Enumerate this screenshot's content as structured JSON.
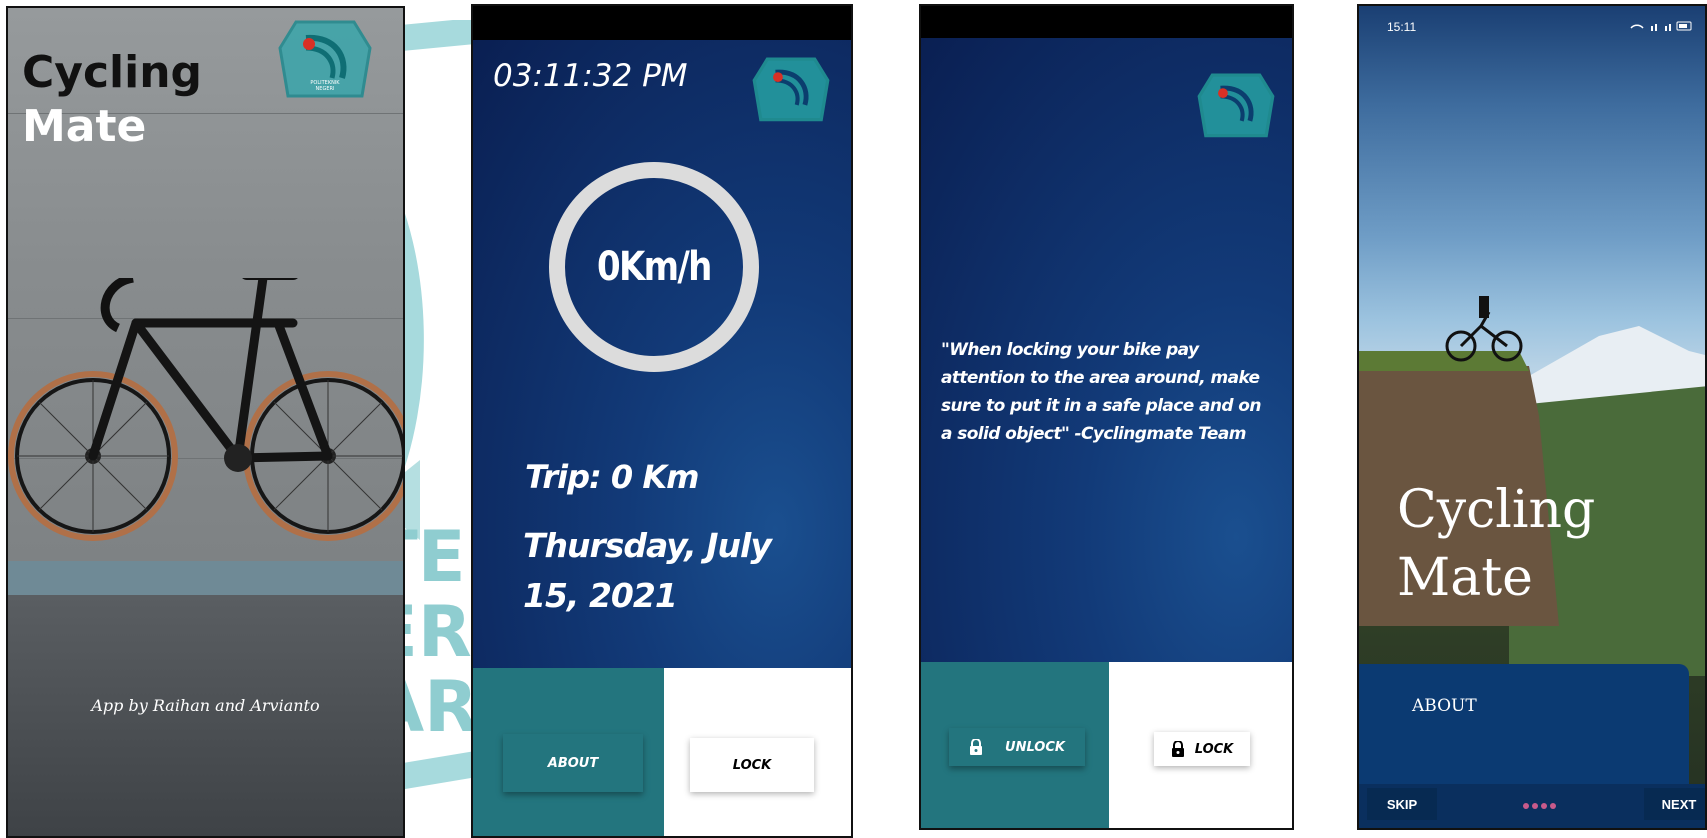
{
  "splash": {
    "title_line1": "Cycling",
    "title_line2": "Mate",
    "credit": "App by Raihan and Arvianto"
  },
  "watermark": {
    "lines": [
      "TE",
      "ER",
      "AR"
    ]
  },
  "logo": {
    "text_line1": "POLITEKNIK",
    "text_line2": "NEGERI",
    "text_line3": "JAKARTA",
    "accent_color": "#d93025",
    "ring_color": "#1f8a8f"
  },
  "speedometer": {
    "time": "03:11:32 PM",
    "speed": "0Km/h",
    "trip": "Trip:  0 Km",
    "date": "Thursday, July 15, 2021",
    "about_label": "ABOUT",
    "lock_label": "LOCK"
  },
  "lock_screen": {
    "quote": "\"When locking your bike pay attention to the area around, make sure to put it in a safe place and on a solid object\" -Cyclingmate Team",
    "unlock_label": "UNLOCK",
    "lock_label": "LOCK"
  },
  "onboarding": {
    "status_time": "15:11",
    "title_line1": "Cycling",
    "title_line2": "Mate",
    "section_label": "ABOUT",
    "skip_label": "SKIP",
    "next_label": "NEXT",
    "page_count": 4
  },
  "colors": {
    "teal": "#23757e",
    "navy": "#0a1f52"
  }
}
